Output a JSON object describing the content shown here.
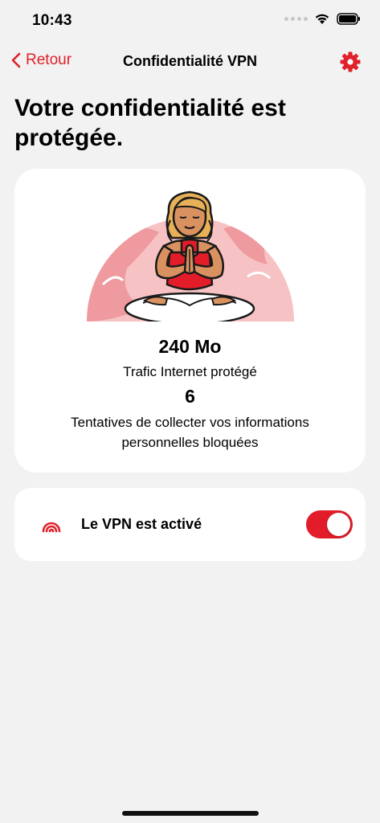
{
  "status_bar": {
    "time": "10:43"
  },
  "nav": {
    "back_label": "Retour",
    "title": "Confidentialité VPN"
  },
  "page": {
    "title": "Votre confidentialité est protégée."
  },
  "stats": {
    "traffic_value": "240 Mo",
    "traffic_label": "Trafic Internet protégé",
    "blocked_value": "6",
    "blocked_label": "Tentatives de collecter vos informations personnelles bloquées"
  },
  "vpn": {
    "label": "Le VPN est activé",
    "enabled": true
  },
  "colors": {
    "accent": "#e0202a",
    "background": "#f2f2f2",
    "card": "#ffffff",
    "illustration_pink": "#f7c2c4",
    "illustration_deep_pink": "#ef9a9e"
  },
  "icons": {
    "back": "chevron-left-icon",
    "settings": "gear-icon",
    "vpn": "signal-waves-icon",
    "wifi": "wifi-icon",
    "battery": "battery-icon"
  }
}
